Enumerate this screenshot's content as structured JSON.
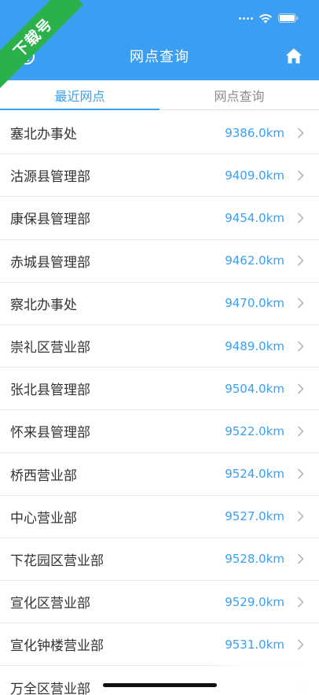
{
  "watermark": "下载号",
  "header": {
    "title": "网点查询"
  },
  "tabs": [
    {
      "label": "最近网点",
      "active": true
    },
    {
      "label": "网点查询",
      "active": false
    }
  ],
  "colors": {
    "accent": "#3a9ff2",
    "watermark": "#2bb14c"
  },
  "icons": {
    "back": "back-icon",
    "home": "home-icon",
    "chevron": "chevron-right-icon"
  },
  "outlets": [
    {
      "name": "塞北办事处",
      "distance": "9386.0km"
    },
    {
      "name": "沽源县管理部",
      "distance": "9409.0km"
    },
    {
      "name": "康保县管理部",
      "distance": "9454.0km"
    },
    {
      "name": "赤城县管理部",
      "distance": "9462.0km"
    },
    {
      "name": "察北办事处",
      "distance": "9470.0km"
    },
    {
      "name": "崇礼区营业部",
      "distance": "9489.0km"
    },
    {
      "name": "张北县管理部",
      "distance": "9504.0km"
    },
    {
      "name": "怀来县管理部",
      "distance": "9522.0km"
    },
    {
      "name": "桥西营业部",
      "distance": "9524.0km"
    },
    {
      "name": "中心营业部",
      "distance": "9527.0km"
    },
    {
      "name": "下花园区营业部",
      "distance": "9528.0km"
    },
    {
      "name": "宣化区营业部",
      "distance": "9529.0km"
    },
    {
      "name": "宣化钟楼营业部",
      "distance": "9531.0km"
    },
    {
      "name": "万全区营业部",
      "distance": ""
    }
  ]
}
